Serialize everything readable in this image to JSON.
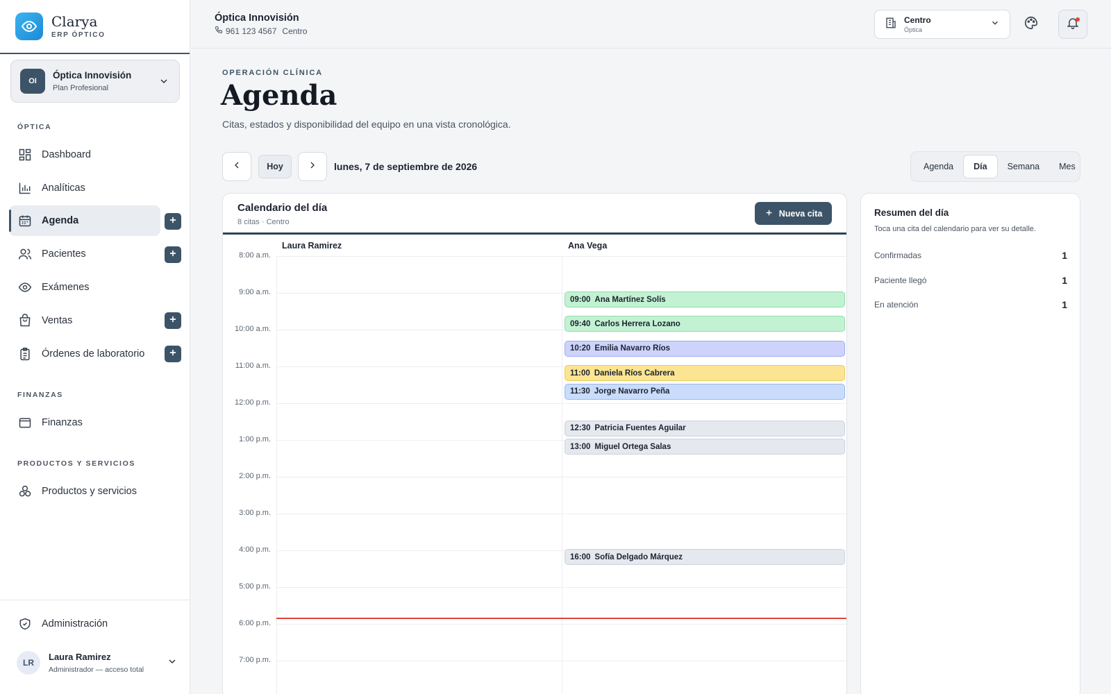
{
  "brand": {
    "name": "Clarya",
    "subtitle": "ERP ÓPTICO"
  },
  "org": {
    "initials": "OI",
    "name": "Óptica Innovisión",
    "plan": "Plan Profesional"
  },
  "sidebar": {
    "sections": {
      "optica": "ÓPTICA",
      "finanzas": "FINANZAS",
      "productos": "PRODUCTOS Y SERVICIOS"
    },
    "items": [
      {
        "label": "Dashboard",
        "icon": "dashboard-icon"
      },
      {
        "label": "Analíticas",
        "icon": "chart-icon"
      },
      {
        "label": "Agenda",
        "icon": "calendar-icon",
        "active": true
      },
      {
        "label": "Pacientes",
        "icon": "users-icon"
      },
      {
        "label": "Exámenes",
        "icon": "eye-icon"
      },
      {
        "label": "Ventas",
        "icon": "bag-icon"
      },
      {
        "label": "Órdenes de laboratorio",
        "icon": "clipboard-icon"
      },
      {
        "label": "Finanzas",
        "icon": "wallet-icon"
      },
      {
        "label": "Productos y servicios",
        "icon": "boxes-icon"
      },
      {
        "label": "Administración",
        "icon": "shield-icon"
      }
    ],
    "user": {
      "initials": "LR",
      "name": "Laura Ramirez",
      "role": "Administrador — acceso total"
    }
  },
  "topbar": {
    "title": "Óptica Innovisión",
    "phone": "961 123 4567",
    "branch_text": "Centro",
    "branch_select": {
      "value": "Centro",
      "sub": "Óptica"
    }
  },
  "header": {
    "eyebrow": "OPERACIÓN CLÍNICA",
    "title": "Agenda",
    "description": "Citas, estados y disponibilidad del equipo en una vista cronológica."
  },
  "toolbar": {
    "today_label": "Hoy",
    "date_label": "lunes, 7 de septiembre de 2026",
    "views": [
      "Agenda",
      "Día",
      "Semana",
      "Mes"
    ],
    "active_view": "Día"
  },
  "calendar": {
    "title": "Calendario del día",
    "subtitle": "8 citas · Centro",
    "new_button": "Nueva cita",
    "columns": [
      "Laura Ramirez",
      "Ana Vega"
    ],
    "hours": [
      "8:00 a.m.",
      "9:00 a.m.",
      "10:00 a.m.",
      "11:00 a.m.",
      "12:00 p.m.",
      "1:00 p.m.",
      "2:00 p.m.",
      "3:00 p.m.",
      "4:00 p.m.",
      "5:00 p.m.",
      "6:00 p.m.",
      "7:00 p.m."
    ],
    "current_time": "17:50",
    "appointments": [
      {
        "time": "09:00",
        "patient": "Ana Martínez Solís",
        "color": "#c3f2d2",
        "border": "#8fdcaa"
      },
      {
        "time": "09:40",
        "patient": "Carlos Herrera Lozano",
        "color": "#c3f2d2",
        "border": "#8fdcaa"
      },
      {
        "time": "10:20",
        "patient": "Emilia Navarro Ríos",
        "color": "#cdd3fa",
        "border": "#a2acee"
      },
      {
        "time": "11:00",
        "patient": "Daniela Ríos Cabrera",
        "color": "#fbe592",
        "border": "#e8cc5c"
      },
      {
        "time": "11:30",
        "patient": "Jorge Navarro Peña",
        "color": "#c9dcfb",
        "border": "#98b8ec"
      },
      {
        "time": "12:30",
        "patient": "Patricia Fuentes Aguilar",
        "color": "#e5e8ee",
        "border": "#cdd2da"
      },
      {
        "time": "13:00",
        "patient": "Miguel Ortega Salas",
        "color": "#e5e8ee",
        "border": "#cdd2da"
      },
      {
        "time": "16:00",
        "patient": "Sofía Delgado Márquez",
        "color": "#e5e8ee",
        "border": "#cdd2da"
      }
    ]
  },
  "summary": {
    "title": "Resumen del día",
    "subtitle": "Toca una cita del calendario para ver su detalle.",
    "rows": [
      {
        "label": "Confirmadas",
        "value": "1"
      },
      {
        "label": "Paciente llegó",
        "value": "1"
      },
      {
        "label": "En atención",
        "value": "1"
      }
    ]
  }
}
